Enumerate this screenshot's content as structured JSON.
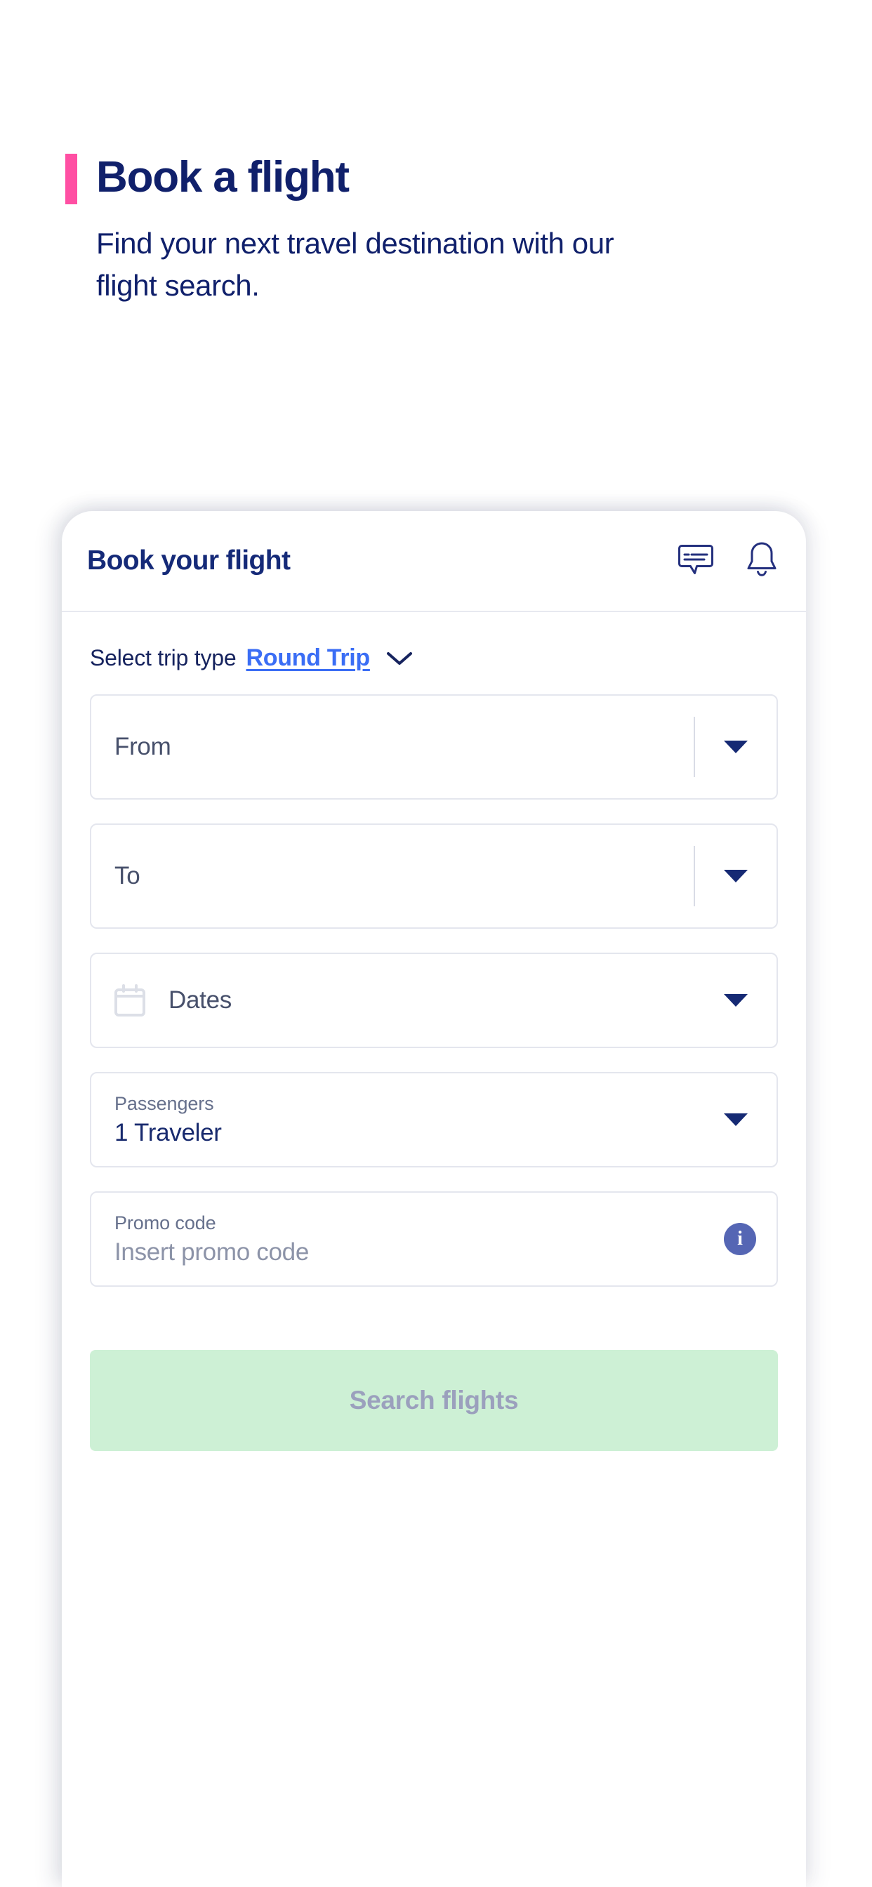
{
  "hero": {
    "title": "Book a flight",
    "subtitle": "Find your next travel destination with our flight search.",
    "accent_color": "#ff4fa3",
    "text_color": "#10206b"
  },
  "card": {
    "header": {
      "title": "Book your flight",
      "icons": [
        {
          "name": "chat-icon",
          "label": "Messages"
        },
        {
          "name": "bell-icon",
          "label": "Notifications"
        }
      ]
    },
    "trip_type": {
      "label": "Select trip type",
      "value": "Round Trip",
      "chevron": "chevron-down-icon",
      "link_color": "#3b6ef5"
    },
    "fields": [
      {
        "name": "from",
        "placeholder": "From",
        "has_divider": true,
        "control": "caret"
      },
      {
        "name": "to",
        "placeholder": "To",
        "has_divider": true,
        "control": "caret"
      },
      {
        "name": "dates",
        "placeholder": "Dates",
        "icon": "calendar-icon",
        "has_divider": false,
        "control": "caret"
      },
      {
        "name": "passengers",
        "label": "Passengers",
        "value": "1 Traveler",
        "has_divider": false,
        "control": "caret"
      },
      {
        "name": "promo",
        "label": "Promo code",
        "placeholder": "Insert promo code",
        "has_divider": false,
        "control": "info"
      }
    ],
    "submit": {
      "label": "Search flights",
      "background": "#cdf0d5",
      "text_color": "#9ba0bd",
      "enabled": false
    }
  }
}
